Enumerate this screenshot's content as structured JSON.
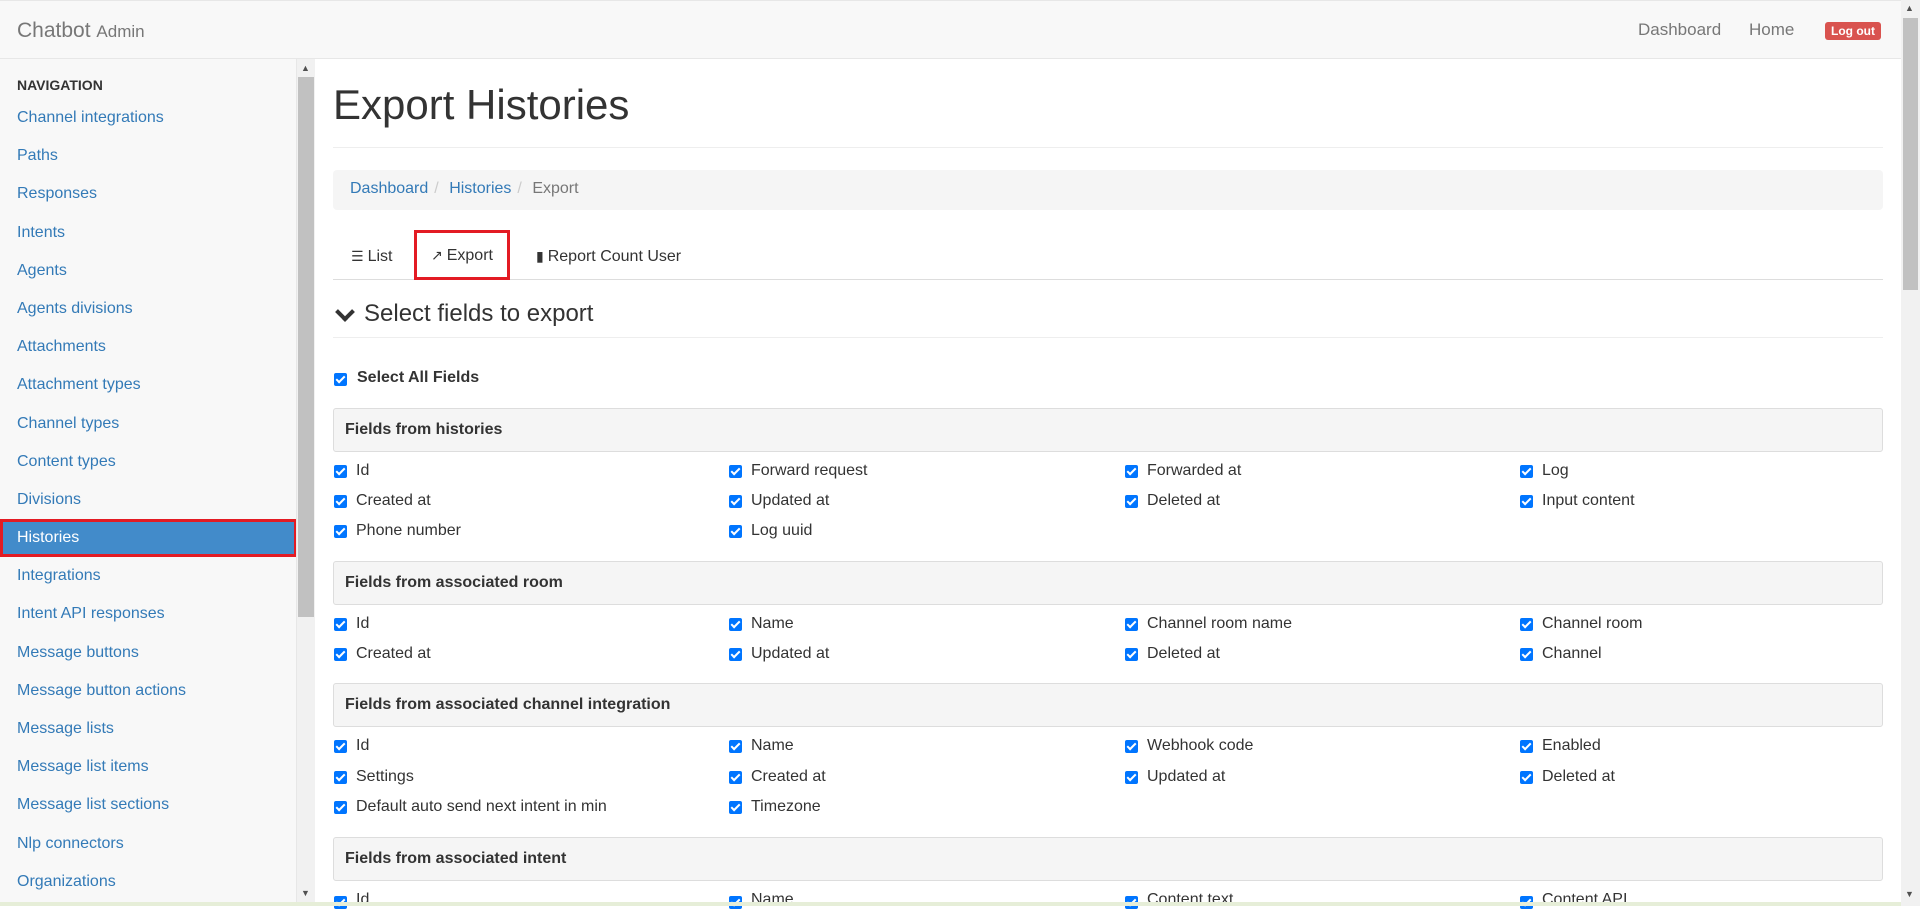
{
  "navbar": {
    "brand": "Chatbot",
    "brand_sub": "Admin",
    "dashboard": "Dashboard",
    "home": "Home",
    "logout": "Log out"
  },
  "sidebar": {
    "heading": "NAVIGATION",
    "items": [
      {
        "label": "Channel integrations"
      },
      {
        "label": "Paths"
      },
      {
        "label": "Responses"
      },
      {
        "label": "Intents"
      },
      {
        "label": "Agents"
      },
      {
        "label": "Agents divisions"
      },
      {
        "label": "Attachments"
      },
      {
        "label": "Attachment types"
      },
      {
        "label": "Channel types"
      },
      {
        "label": "Content types"
      },
      {
        "label": "Divisions"
      },
      {
        "label": "Histories",
        "active": true
      },
      {
        "label": "Integrations"
      },
      {
        "label": "Intent API responses"
      },
      {
        "label": "Message buttons"
      },
      {
        "label": "Message button actions"
      },
      {
        "label": "Message lists"
      },
      {
        "label": "Message list items"
      },
      {
        "label": "Message list sections"
      },
      {
        "label": "Nlp connectors"
      },
      {
        "label": "Organizations"
      }
    ]
  },
  "main": {
    "title": "Export Histories",
    "breadcrumb": {
      "dashboard": "Dashboard",
      "histories": "Histories",
      "current": "Export"
    },
    "tabs": {
      "list": "List",
      "export": "Export",
      "report": "Report Count User"
    },
    "section_title": "Select fields to export",
    "select_all": "Select All Fields",
    "groups": [
      {
        "title": "Fields from histories",
        "fields": [
          "Id",
          "Forward request",
          "Forwarded at",
          "Log",
          "Created at",
          "Updated at",
          "Deleted at",
          "Input content",
          "Phone number",
          "Log uuid"
        ]
      },
      {
        "title": "Fields from associated room",
        "fields": [
          "Id",
          "Name",
          "Channel room name",
          "Channel room",
          "Created at",
          "Updated at",
          "Deleted at",
          "Channel"
        ]
      },
      {
        "title": "Fields from associated channel integration",
        "fields": [
          "Id",
          "Name",
          "Webhook code",
          "Enabled",
          "Settings",
          "Created at",
          "Updated at",
          "Deleted at",
          "Default auto send next intent in min",
          "Timezone"
        ]
      },
      {
        "title": "Fields from associated intent",
        "fields": [
          "Id",
          "Name",
          "Content text",
          "Content API"
        ]
      }
    ]
  },
  "colors": {
    "link": "#337ab7",
    "active_bg": "#428bca",
    "highlight_border": "#e31b23",
    "logout_bg": "#d9534f",
    "checkbox": "#0075ff"
  }
}
